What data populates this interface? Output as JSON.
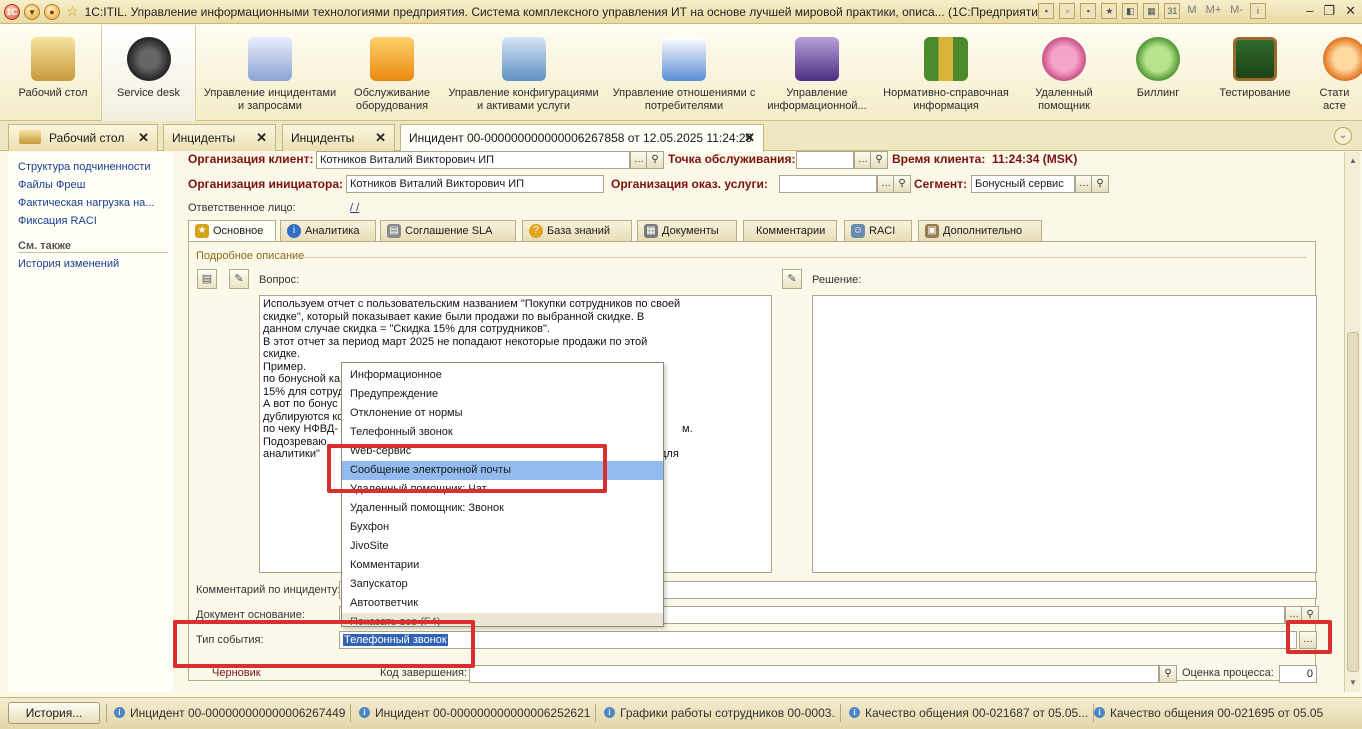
{
  "window": {
    "title": "1С:ITIL. Управление информационными технологиями предприятия. Система комплексного управления ИТ на основе лучшей мировой практики, описа... (1С:Предприятие)",
    "app_badge": "1С",
    "tools": [
      "M",
      "M+",
      "M-"
    ]
  },
  "sections": [
    {
      "label": "Рабочий стол"
    },
    {
      "label": "Service desk"
    },
    {
      "label": "Управление инцидентами и запросами"
    },
    {
      "label": "Обслуживание оборудования"
    },
    {
      "label": "Управление конфигурациями и активами услуги"
    },
    {
      "label": "Управление отношениями с потребителями"
    },
    {
      "label": "Управление информационной..."
    },
    {
      "label": "Нормативно-справочная информация"
    },
    {
      "label": "Удаленный помощник"
    },
    {
      "label": "Биллинг"
    },
    {
      "label": "Тестирование"
    },
    {
      "label": "Стати асте"
    }
  ],
  "tabs": [
    {
      "label": "Рабочий стол"
    },
    {
      "label": "Инциденты"
    },
    {
      "label": "Инциденты"
    },
    {
      "label": "Инцидент 00-000000000000006267858 от 12.05.2025 11:24:29"
    }
  ],
  "nav": {
    "links": [
      "Структура подчиненности",
      "Файлы Фреш",
      "Фактическая нагрузка на...",
      "Фиксация RACI"
    ],
    "see_also": "См. также",
    "see_also_links": [
      "История изменений"
    ]
  },
  "form": {
    "client_org_label": "Организация клиент:",
    "client_org_value": "Котников Виталий Викторович ИП",
    "service_point_label": "Точка обслуживания:",
    "client_time_label": "Время клиента:",
    "client_time_value": "11:24:34 (MSK)",
    "initiator_label": "Организация инициатора:",
    "initiator_value": "Котников Виталий Викторович ИП",
    "provider_label": "Организация оказ. услуги:",
    "segment_label": "Сегмент:",
    "segment_value": "Бонусный сервис",
    "responsible_label": "Ответственное лицо:",
    "responsible_value": "/ /",
    "inner_tabs": [
      "Основное",
      "Аналитика",
      "Соглашение SLA",
      "База знаний",
      "Документы",
      "Комментарии",
      "RACI",
      "Дополнительно"
    ],
    "detail_group": "Подробное описание",
    "question_label": "Вопрос:",
    "solution_label": "Решение:",
    "question_lines": [
      "Используем отчет с пользовательским названием \"Покупки сотрудников по своей",
      "скидке\", который показывает какие были продажи по выбранной скидке. В",
      "данном случае скидка = \"Скидка 15% для сотрудников\".",
      "В этот отчет за период март 2025 не попадают некоторые продажи по этой",
      "скидке.",
      "Пример.",
      "по бонусной ка",
      "15% для сотруд",
      "А вот по бонус",
      "дублируются ко",
      "по чеку НФВД-",
      "Подозреваю,",
      "аналитики\""
    ],
    "question_tail": {
      "line10": "м.",
      "line12": "для"
    },
    "comment_label": "Комментарий по инциденту:",
    "base_doc_label": "Документ основание:",
    "event_type_label": "Тип события:",
    "event_type_value": "Телефонный звонок",
    "status_link": "Черновик",
    "completion_code_label": "Код завершения:",
    "process_score_label": "Оценка процесса:",
    "process_score_value": "0"
  },
  "dropdown": {
    "items": [
      "Информационное",
      "Предупреждение",
      "Отклонение от нормы",
      "Телефонный звонок",
      "Web-сервис",
      "Сообщение электронной почты",
      "Удаленный помощник: Чат",
      "Удаленный помощник: Звонок",
      "Бухфон",
      "JivoSite",
      "Комментарии",
      "Запускатор",
      "Автоответчик"
    ],
    "selected_index": 5,
    "more_label": "Показать все (F4)"
  },
  "taskbar": {
    "history_button": "История...",
    "tasks": [
      "Инцидент 00-000000000000006267449 ...",
      "Инцидент 00-000000000000006252621 ...",
      "Графики работы сотрудников 00-0003...",
      "Качество общения 00-021687 от 05.05....",
      "Качество общения 00-021695 от 05.05...."
    ]
  },
  "colors": {
    "accent_red": "#d8302e",
    "selection_blue": "#93bbf0",
    "required_label": "#7b1212",
    "link_blue": "#1a3d8f"
  }
}
